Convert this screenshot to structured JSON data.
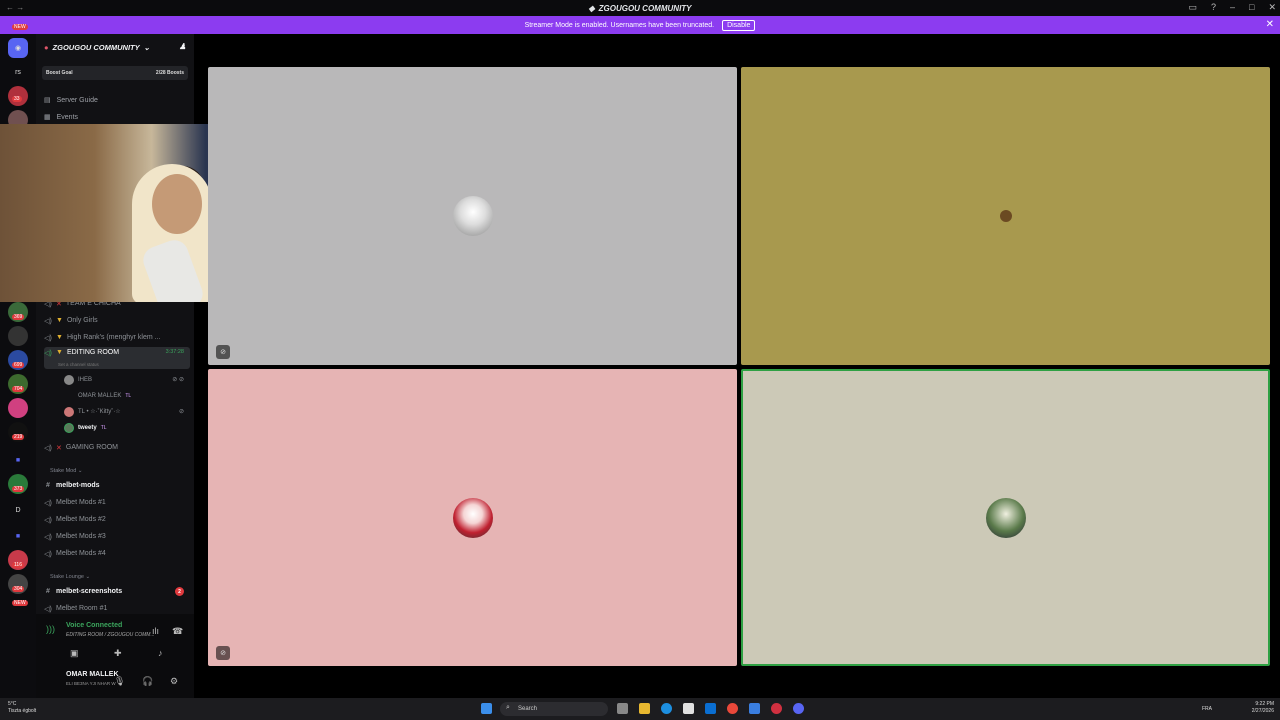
{
  "window": {
    "title": "ZGOUGOU COMMUNITY"
  },
  "banner": {
    "text": "Streamer Mode is enabled. Usernames have been truncated.",
    "button": "Disable"
  },
  "rail": {
    "badges": [
      "NEW",
      "33",
      "369",
      "699",
      "704",
      "219",
      "373",
      "116",
      "304",
      "NEW"
    ],
    "letters": [
      "rs",
      "D"
    ]
  },
  "sidebar": {
    "server_name": "ZGOUGOU COMMUNITY",
    "boost_label": "Boost Goal",
    "boost_count": "2/28 Boosts",
    "nav": [
      "Server Guide",
      "Events"
    ],
    "channels": [
      {
        "name": "TEAM E CHICHA"
      },
      {
        "name": "Only Girls"
      },
      {
        "name": "High Rank's (menghyr klem ..."
      },
      {
        "name": "EDITING ROOM",
        "time": "3:37:28",
        "status": "Set a channel status"
      },
      {
        "name": "GAMING ROOM"
      }
    ],
    "voice_users": [
      {
        "name": "IHEB",
        "tag": ""
      },
      {
        "name": "OMAR MALLEK",
        "tag": "TL"
      },
      {
        "name": "TL • ☆·˚Kitty˚·☆",
        "tag": ""
      },
      {
        "name": "tweety",
        "tag": "TL"
      }
    ],
    "categories": [
      "Stake Mod",
      "Stake Lounge"
    ],
    "stake_channels": [
      "melbet-mods",
      "Melbet Mods #1",
      "Melbet Mods #2",
      "Melbet Mods #3",
      "Melbet Mods #4"
    ],
    "lounge_channels": [
      {
        "name": "melbet-screenshots",
        "ping": "2"
      },
      {
        "name": "Melbet Room #1",
        "ping": ""
      }
    ]
  },
  "voice_panel": {
    "status": "Voice Connected",
    "location": "EDITING ROOM / ZGOUGOU COMM...",
    "user_name": "OMAR MALLEK",
    "user_status": "ELI BE3NA YJI NHAR W"
  },
  "taskbar": {
    "weather_temp": "5°C",
    "weather_desc": "Tiszta égbolt",
    "search_placeholder": "Search",
    "lang": "FRA",
    "time": "9:22 PM",
    "date": "2/27/2026"
  },
  "colors": {
    "banner": "#8c3cf0",
    "tile1": "#b9b8b9",
    "tile2": "#a8994e",
    "tile3": "#e6b4b4",
    "tile4": "#ccc9b7",
    "speaking_border": "#2ea043"
  }
}
